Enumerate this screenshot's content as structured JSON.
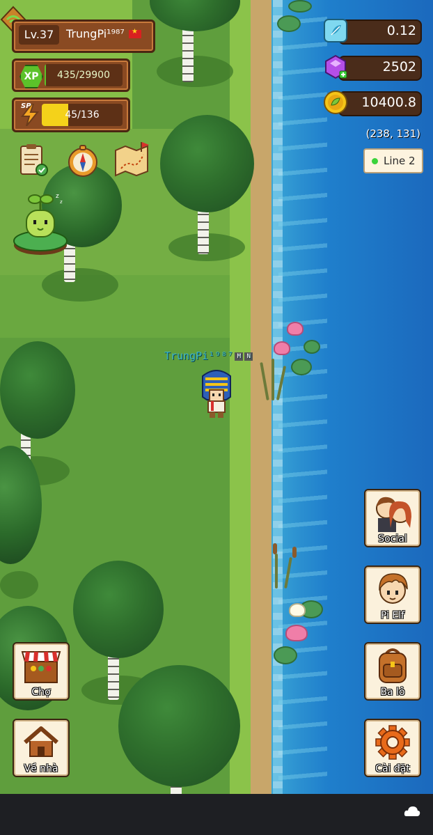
{
  "player": {
    "level": "Lv.37",
    "name": "TrungPi¹⁹⁸⁷",
    "flag_color": "#d92020",
    "xp_label": "XP",
    "xp_text": "435/29900",
    "xp_current": 435,
    "xp_max": 29900,
    "sp_label": "SP",
    "sp_text": "45/136",
    "sp_current": 45,
    "sp_max": 136
  },
  "resources": {
    "diamond": "0.12",
    "gems": "2502",
    "coins": "10400.8"
  },
  "map": {
    "coordinates": "(238, 131)",
    "server_line": "Line 2",
    "server_status_color": "#3bd33b"
  },
  "character": {
    "name_tag": "TrungPi¹⁹⁸⁷",
    "badges": [
      "M",
      "N"
    ]
  },
  "quick_tools": [
    "quest-scroll-icon",
    "compass-icon",
    "treasure-map-icon"
  ],
  "side_menu": {
    "social": "Social",
    "pi_elf": "Pi Elf",
    "backpack": "Ba lô",
    "settings": "Cài đặt"
  },
  "left_menu": {
    "market": "Chợ",
    "home": "Về nhà"
  },
  "colors": {
    "panel_brown": "#8a4a22",
    "xp_green": "#5cc22a",
    "sp_yellow": "#f4d21a",
    "water_blue": "#1f7fcc",
    "grass_green": "#5f9e3d"
  }
}
